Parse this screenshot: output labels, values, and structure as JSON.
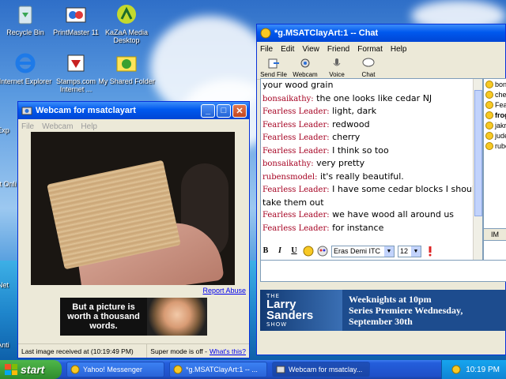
{
  "desktop": {
    "icons": [
      {
        "label": "Recycle Bin",
        "icon": "recycle-bin-icon"
      },
      {
        "label": "PrintMaster 11",
        "icon": "printmaster-icon"
      },
      {
        "label": "KaZaA Media Desktop",
        "icon": "kazaa-icon"
      },
      {
        "label": "Internet Explorer",
        "icon": "internet-explorer-icon"
      },
      {
        "label": "Stamps.com Internet ...",
        "icon": "stamps-icon"
      },
      {
        "label": "My Shared Folder",
        "icon": "shared-folder-icon"
      }
    ],
    "partial_labels": [
      "Exp",
      "Inst Onli",
      "Net",
      "Anti"
    ]
  },
  "chat_window": {
    "title": "*g.MSATClayArt:1  -- Chat",
    "menu": [
      "File",
      "Edit",
      "View",
      "Friend",
      "Format",
      "Help"
    ],
    "toolbar": [
      {
        "label": "Send File",
        "icon": "send-file-icon"
      },
      {
        "label": "Webcam",
        "icon": "webcam-icon"
      },
      {
        "label": "Voice",
        "icon": "voice-icon"
      },
      {
        "label": "Chat",
        "icon": "chat-icon"
      }
    ],
    "messages": [
      {
        "speaker": "",
        "text": "your wood grain"
      },
      {
        "speaker": "bonsaikathy:",
        "text": "the one looks like cedar NJ"
      },
      {
        "speaker": "Fearless Leader:",
        "text": "light, dark"
      },
      {
        "speaker": "Fearless Leader:",
        "text": "redwood"
      },
      {
        "speaker": "Fearless Leader:",
        "text": "cherry"
      },
      {
        "speaker": "Fearless Leader:",
        "text": "I think so too"
      },
      {
        "speaker": "bonsaikathy:",
        "text": "very pretty"
      },
      {
        "speaker": "rubensmodel:",
        "text": "it's really beautiful."
      },
      {
        "speaker": "Fearless Leader:",
        "text": "I have some cedar blocks I should take them out"
      },
      {
        "speaker": "Fearless Leader:",
        "text": "we have wood all around us"
      },
      {
        "speaker": "Fearless Leader:",
        "text": "for instance"
      }
    ],
    "buddies": [
      "bon",
      "che",
      "Fea",
      "frog",
      "jakr",
      "jude",
      "rube"
    ],
    "im_button": "IM",
    "format": {
      "bold": "B",
      "italic": "I",
      "underline": "U",
      "font": "Eras Demi ITC",
      "size": "12"
    },
    "ad": {
      "logo_small": "THE",
      "logo_big_1": "Larry",
      "logo_big_2": "Sanders",
      "logo_tag": "SHOW",
      "line1": "Weeknights at 10pm",
      "line2": "Series Premiere Wednesday,",
      "line3": "September 30th"
    }
  },
  "webcam_window": {
    "title": "Webcam for msatclayart",
    "menu": [
      "File",
      "Webcam",
      "Help"
    ],
    "report_link": "Report Abuse",
    "ad_text": "But a picture is worth a thousand words.",
    "status_left": "Last image received at (10:19:49 PM)",
    "status_right": "Super mode is off -",
    "status_link": "What's this?"
  },
  "taskbar": {
    "start": "start",
    "items": [
      {
        "label": "Yahoo! Messenger",
        "icon": "yahoo-messenger-icon"
      },
      {
        "label": "*g.MSATClayArt:1 -- ...",
        "icon": "chat-window-icon"
      },
      {
        "label": "Webcam for msatclay...",
        "icon": "webcam-window-icon"
      }
    ],
    "clock": "10:19 PM"
  }
}
